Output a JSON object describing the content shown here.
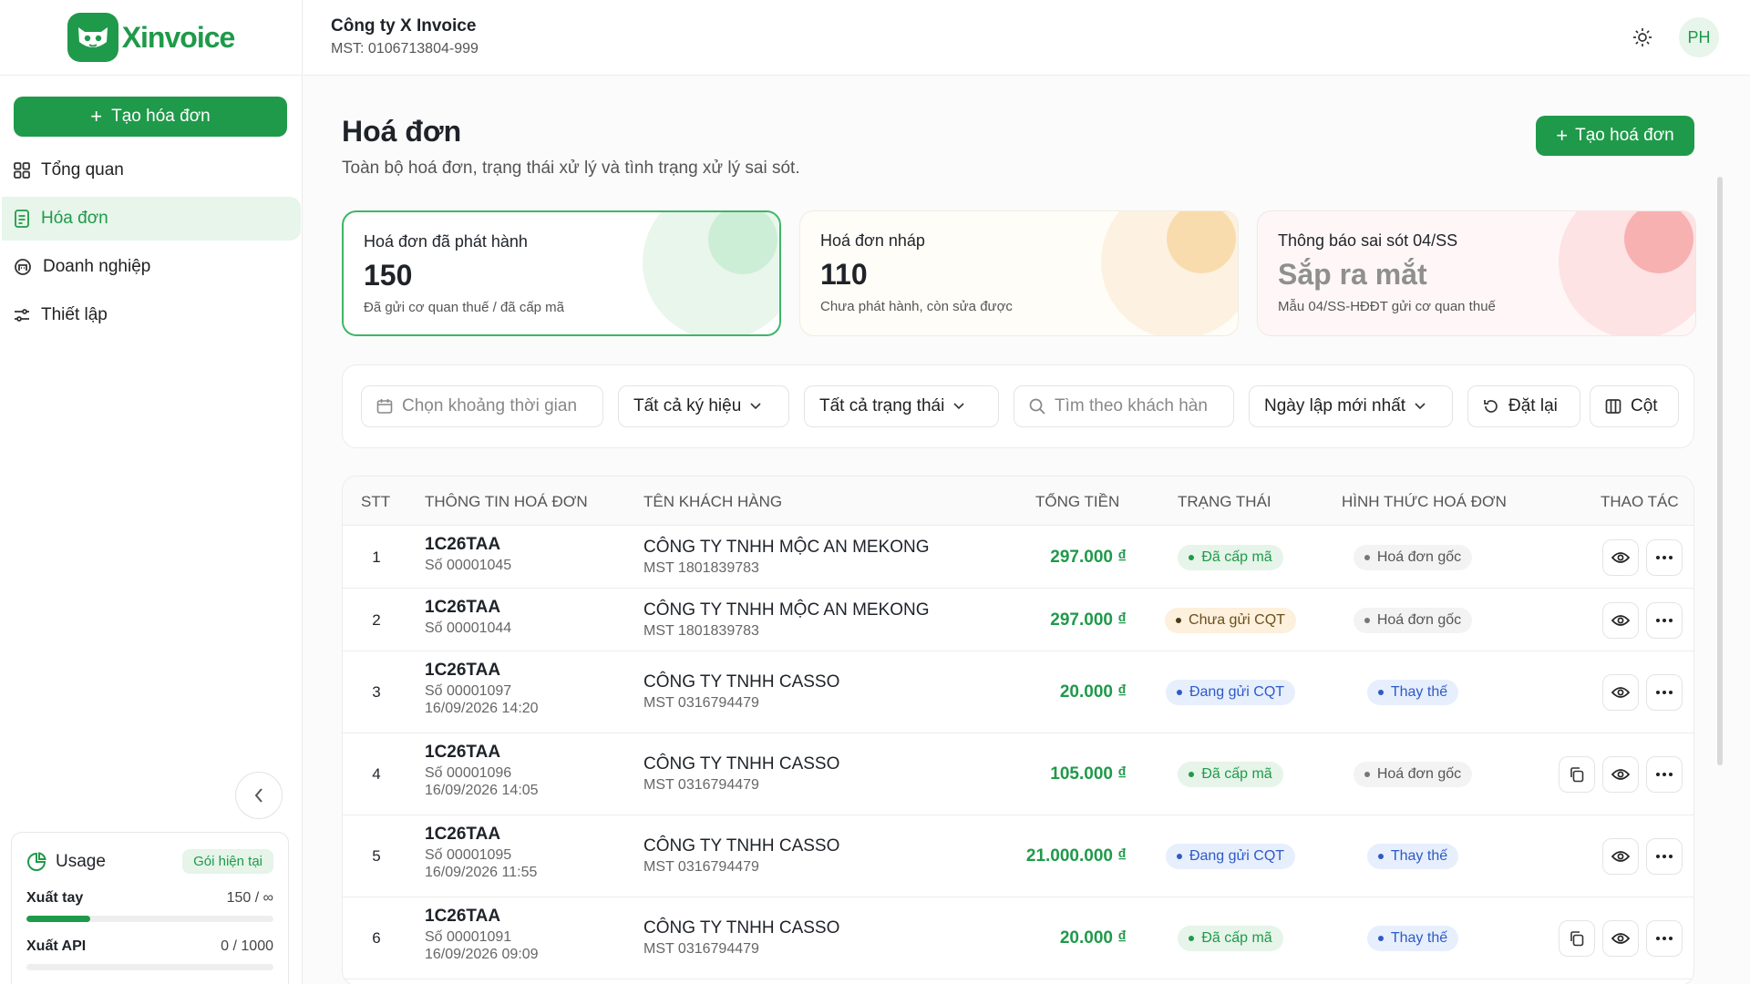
{
  "app": {
    "logo_text": "Xinvoice"
  },
  "sidebar": {
    "create_label": "Tạo hóa đơn",
    "items": [
      {
        "label": "Tổng quan",
        "icon": "grid-icon",
        "active": false
      },
      {
        "label": "Hóa đơn",
        "icon": "document-icon",
        "active": true
      },
      {
        "label": "Doanh nghiệp",
        "icon": "building-icon",
        "active": false
      },
      {
        "label": "Thiết lập",
        "icon": "sliders-icon",
        "active": false
      }
    ],
    "usage": {
      "title": "Usage",
      "badge": "Gói hiện tại",
      "rows": [
        {
          "label": "Xuất tay",
          "value": "150 / ∞",
          "fill": 0.26
        },
        {
          "label": "Xuất API",
          "value": "0 / 1000",
          "fill": 0.0
        }
      ]
    }
  },
  "header": {
    "company_name": "Công ty X Invoice",
    "company_mst": "MST: 0106713804-999",
    "avatar_initials": "PH"
  },
  "page": {
    "title": "Hoá đơn",
    "subtitle": "Toàn bộ hoá đơn, trạng thái xử lý và tình trạng xử lý sai sót.",
    "create_label": "Tạo hoá đơn"
  },
  "cards": [
    {
      "title": "Hoá đơn đã phát hành",
      "value": "150",
      "desc": "Đã gửi cơ quan thuế / đã cấp mã"
    },
    {
      "title": "Hoá đơn nháp",
      "value": "110",
      "desc": "Chưa phát hành, còn sửa được"
    },
    {
      "title": "Thông báo sai sót 04/SS",
      "value": "Sắp ra mắt",
      "desc": "Mẫu 04/SS-HĐĐT gửi cơ quan thuế"
    }
  ],
  "filters": {
    "date_placeholder": "Chọn khoảng thời gian",
    "symbol": "Tất cả ký hiệu",
    "status": "Tất cả trạng thái",
    "search_placeholder": "Tìm theo khách hàn",
    "sort": "Ngày lập mới nhất",
    "reset": "Đặt lại",
    "columns": "Cột"
  },
  "table": {
    "headers": [
      "STT",
      "THÔNG TIN HOÁ ĐƠN",
      "TÊN KHÁCH HÀNG",
      "TỔNG TIỀN",
      "TRẠNG THÁI",
      "HÌNH THỨC HOÁ ĐƠN",
      "THAO TÁC"
    ],
    "rows": [
      {
        "stt": "1",
        "code": "1C26TAA",
        "number": "Số 00001045",
        "date": "",
        "customer": "CÔNG TY TNHH MỘC AN MEKONG",
        "mst": "MST 1801839783",
        "amount": "297.000 ₫",
        "status": "Đã cấp mã",
        "status_tone": "green",
        "form": "Hoá đơn gốc",
        "form_tone": "gray",
        "copy": false
      },
      {
        "stt": "2",
        "code": "1C26TAA",
        "number": "Số 00001044",
        "date": "",
        "customer": "CÔNG TY TNHH MỘC AN MEKONG",
        "mst": "MST 1801839783",
        "amount": "297.000 ₫",
        "status": "Chưa gửi CQT",
        "status_tone": "yellow",
        "form": "Hoá đơn gốc",
        "form_tone": "gray",
        "copy": false
      },
      {
        "stt": "3",
        "code": "1C26TAA",
        "number": "Số 00001097",
        "date": "16/09/2026 14:20",
        "customer": "CÔNG TY TNHH CASSO",
        "mst": "MST 0316794479",
        "amount": "20.000 ₫",
        "status": "Đang gửi CQT",
        "status_tone": "blue",
        "form": "Thay thế",
        "form_tone": "blue",
        "copy": false
      },
      {
        "stt": "4",
        "code": "1C26TAA",
        "number": "Số 00001096",
        "date": "16/09/2026 14:05",
        "customer": "CÔNG TY TNHH CASSO",
        "mst": "MST 0316794479",
        "amount": "105.000 ₫",
        "status": "Đã cấp mã",
        "status_tone": "green",
        "form": "Hoá đơn gốc",
        "form_tone": "gray",
        "copy": true
      },
      {
        "stt": "5",
        "code": "1C26TAA",
        "number": "Số 00001095",
        "date": "16/09/2026 11:55",
        "customer": "CÔNG TY TNHH CASSO",
        "mst": "MST 0316794479",
        "amount": "21.000.000 ₫",
        "status": "Đang gửi CQT",
        "status_tone": "blue",
        "form": "Thay thế",
        "form_tone": "blue",
        "copy": false
      },
      {
        "stt": "6",
        "code": "1C26TAA",
        "number": "Số 00001091",
        "date": "16/09/2026 09:09",
        "customer": "CÔNG TY TNHH CASSO",
        "mst": "MST 0316794479",
        "amount": "20.000 ₫",
        "status": "Đã cấp mã",
        "status_tone": "green",
        "form": "Thay thế",
        "form_tone": "blue",
        "copy": true
      }
    ]
  },
  "colors": {
    "brand": "#1f9a4a",
    "accent_light": "#e7f5ea"
  }
}
